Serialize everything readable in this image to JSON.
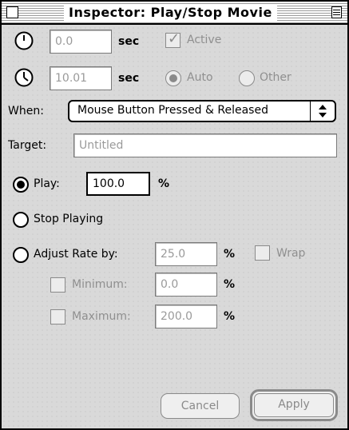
{
  "window": {
    "title": "Inspector: Play/Stop Movie"
  },
  "start": {
    "value": "0.0",
    "unit": "sec",
    "active_label": "Active",
    "active_checked": true
  },
  "duration": {
    "value": "10.01",
    "unit": "sec",
    "options": [
      {
        "label": "Auto",
        "selected": true
      },
      {
        "label": "Other",
        "selected": false
      }
    ]
  },
  "when": {
    "label": "When:",
    "value": "Mouse Button Pressed & Released"
  },
  "target": {
    "label": "Target:",
    "placeholder": "Untitled"
  },
  "actions": {
    "play": {
      "label": "Play:",
      "value": "100.0",
      "unit": "%",
      "selected": true
    },
    "stop": {
      "label": "Stop Playing",
      "selected": false
    },
    "adjust": {
      "label": "Adjust Rate by:",
      "value": "25.0",
      "unit": "%",
      "wrap_label": "Wrap",
      "selected": false
    },
    "minimum": {
      "label": "Minimum:",
      "value": "0.0",
      "unit": "%",
      "checked": false
    },
    "maximum": {
      "label": "Maximum:",
      "value": "200.0",
      "unit": "%",
      "checked": false
    }
  },
  "buttons": {
    "cancel": "Cancel",
    "apply": "Apply"
  }
}
